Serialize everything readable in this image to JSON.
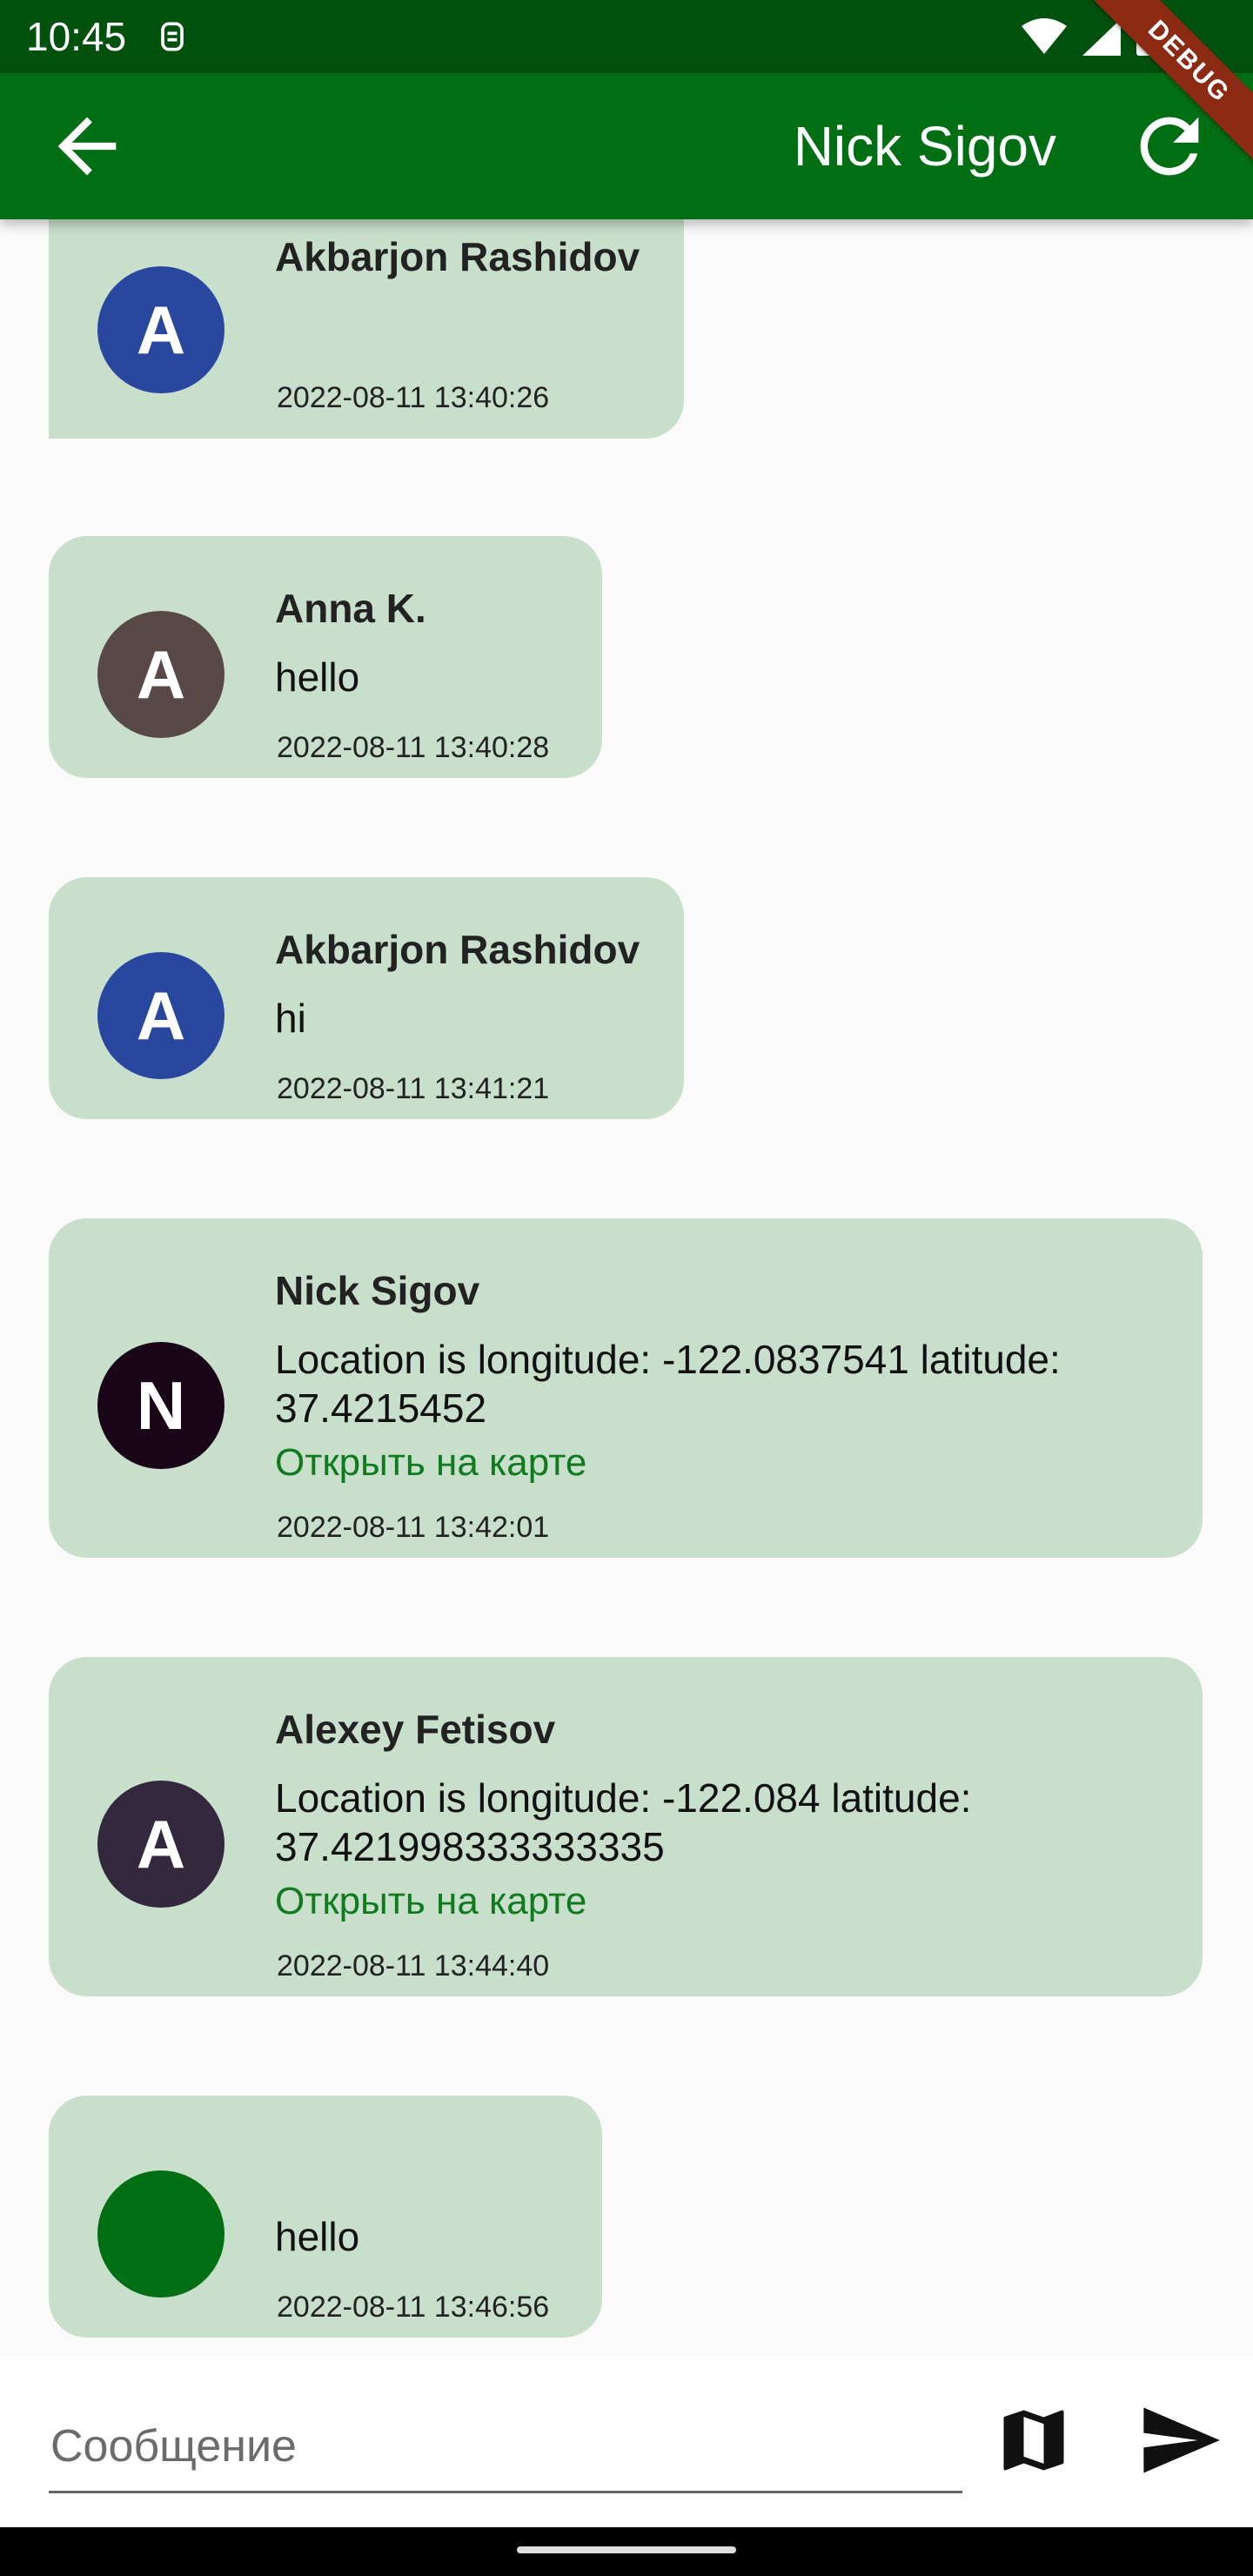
{
  "status": {
    "time": "10:45"
  },
  "debug": {
    "label": "DEBUG"
  },
  "app_bar": {
    "title": "Nick Sigov"
  },
  "messages": [
    {
      "initial": "A",
      "avatar_color": "#2A47A0",
      "sender": "Akbarjon Rashidov",
      "text": "",
      "time": "2022-08-11 13:40:26"
    },
    {
      "initial": "A",
      "avatar_color": "#594848",
      "sender": "Anna K.",
      "text": "hello",
      "time": "2022-08-11 13:40:28"
    },
    {
      "initial": "A",
      "avatar_color": "#2A47A0",
      "sender": "Akbarjon Rashidov",
      "text": "hi",
      "time": "2022-08-11 13:41:21"
    },
    {
      "initial": "N",
      "avatar_color": "#1A0418",
      "sender": "Nick Sigov",
      "text": "Location is  longitude: -122.0837541 latitude: 37.4215452",
      "link": "Открыть на карте",
      "time": "2022-08-11 13:42:01"
    },
    {
      "initial": "A",
      "avatar_color": "#33283D",
      "sender": "Alexey Fetisov",
      "text": "Location is  longitude: -122.084 latitude: 37.421998333333335",
      "link": "Открыть на карте",
      "time": "2022-08-11 13:44:40"
    },
    {
      "initial": "",
      "avatar_color": "#006E13",
      "sender": "",
      "text": "hello",
      "time": "2022-08-11 13:46:56"
    }
  ],
  "input": {
    "placeholder": "Сообщение"
  },
  "colors": {
    "status_bar": "#00500E",
    "app_bar": "#006E13",
    "bubble": "#C8DFCB",
    "link": "#0F7A1E"
  }
}
